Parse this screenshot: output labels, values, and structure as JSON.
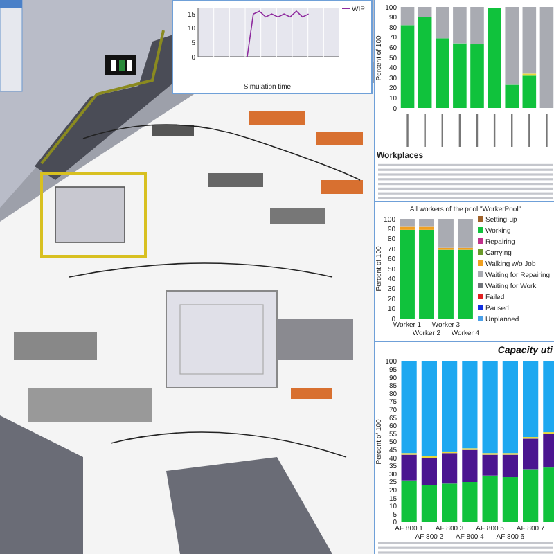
{
  "line_chart": {
    "chart_data": {
      "type": "line",
      "legend": "right",
      "xlabel": "Simulation time",
      "ylim": [
        0,
        17
      ],
      "yticks": [
        0,
        5,
        10,
        15
      ],
      "categories": [
        null,
        null,
        null,
        null,
        null,
        null,
        null,
        null,
        null,
        null,
        null,
        null,
        null,
        null,
        null,
        null,
        null,
        null,
        null,
        null,
        null,
        null,
        null,
        null
      ],
      "series": [
        {
          "name": "WIP",
          "color": "#8e2a9e",
          "values": [
            null,
            null,
            null,
            null,
            null,
            null,
            null,
            null,
            0,
            15,
            16,
            14,
            15,
            14,
            15,
            14,
            16,
            14,
            15,
            null,
            null,
            null,
            null,
            null
          ]
        }
      ]
    }
  },
  "workplaces": {
    "table_title": "Workplaces",
    "chart_data": {
      "type": "bar",
      "stacked": true,
      "ylabel": "Percent of 100",
      "ylim": [
        0,
        100
      ],
      "yticks": [
        0,
        10,
        20,
        30,
        40,
        50,
        60,
        70,
        80,
        90,
        100
      ],
      "categories": [
        null,
        null,
        null,
        null,
        null,
        null,
        null,
        null,
        null
      ],
      "series": [
        {
          "color": "#10c23c",
          "values": [
            82,
            90,
            69,
            64,
            63,
            99,
            23,
            32,
            0
          ]
        },
        {
          "color": "#e8d83a",
          "values": [
            0,
            0,
            0,
            0,
            0,
            0,
            0,
            2,
            0
          ]
        },
        {
          "color": "#a9abb2",
          "values": [
            18,
            10,
            31,
            36,
            37,
            null,
            77,
            66,
            100
          ]
        }
      ]
    }
  },
  "workers": {
    "chart_data": {
      "type": "bar",
      "stacked": true,
      "legend": "right",
      "title": "All workers of the pool \"WorkerPool\"",
      "ylabel": "Percent of 100",
      "ylim": [
        0,
        100
      ],
      "yticks": [
        0,
        10,
        20,
        30,
        40,
        50,
        60,
        70,
        80,
        90,
        100
      ],
      "categories": [
        "Worker 1",
        "Worker 2",
        "Worker 3",
        "Worker 4"
      ],
      "series": [
        {
          "name": "Setting-up",
          "color": "#a0622a",
          "values": [
            0,
            0,
            0,
            0
          ]
        },
        {
          "name": "Working",
          "color": "#10c23c",
          "values": [
            89,
            89,
            69,
            69
          ]
        },
        {
          "name": "Repairing",
          "color": "#c0308a",
          "values": [
            0,
            0,
            0,
            0
          ]
        },
        {
          "name": "Carrying",
          "color": "#6a9a2a",
          "values": [
            0,
            0,
            0,
            0
          ]
        },
        {
          "name": "Walking w/o Job",
          "color": "#f0a020",
          "values": [
            3,
            3,
            2,
            2
          ]
        },
        {
          "name": "Waiting for Repairing",
          "color": "#a9abb2",
          "values": [
            8,
            8,
            29,
            29
          ]
        },
        {
          "name": "Waiting for Work",
          "color": "#70747a",
          "values": [
            0,
            0,
            0,
            0
          ]
        },
        {
          "name": "Failed",
          "color": "#e02020",
          "values": [
            0,
            0,
            0,
            0
          ]
        },
        {
          "name": "Paused",
          "color": "#1030e0",
          "values": [
            0,
            0,
            0,
            0
          ]
        },
        {
          "name": "Unplanned",
          "color": "#4aa0e8",
          "values": [
            0,
            0,
            0,
            0
          ]
        }
      ]
    }
  },
  "capacity": {
    "chart_data": {
      "type": "bar",
      "stacked": true,
      "title": "Capacity uti",
      "ylabel": "Percent of 100",
      "ylim": [
        0,
        100
      ],
      "yticks": [
        0,
        5,
        10,
        15,
        20,
        25,
        30,
        35,
        40,
        45,
        50,
        55,
        60,
        65,
        70,
        75,
        80,
        85,
        90,
        95,
        100
      ],
      "categories": [
        "AF 800 1",
        "AF 800 2",
        "AF 800 3",
        "AF 800 4",
        "AF 800 5",
        "AF 800 6",
        "AF 800 7",
        null
      ],
      "series": [
        {
          "color": "#10c23c",
          "values": [
            26,
            23,
            24,
            25,
            29,
            28,
            33,
            34
          ]
        },
        {
          "color": "#4a1590",
          "values": [
            16,
            17,
            19,
            20,
            13,
            14,
            19,
            21
          ]
        },
        {
          "color": "#e8d83a",
          "values": [
            1,
            1,
            1,
            1,
            1,
            1,
            1,
            1
          ]
        },
        {
          "color": "#1ea8f0",
          "values": [
            57,
            59,
            56,
            54,
            57,
            57,
            47,
            44
          ]
        }
      ]
    }
  }
}
